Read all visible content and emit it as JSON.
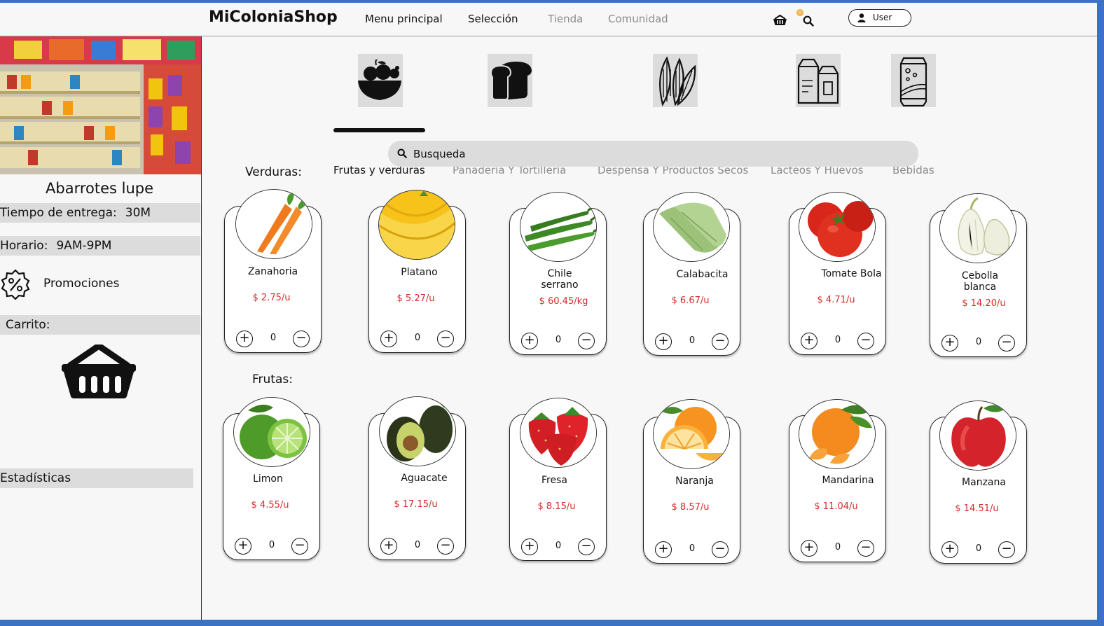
{
  "header": {
    "brand": "MiColoniaShop",
    "nav": [
      "Menu principal",
      "Selección",
      "Tienda",
      "Comunidad"
    ],
    "cart_count": "0",
    "user_label": "User"
  },
  "sidebar": {
    "store_name": "Abarrotes lupe",
    "delivery_label": "Tiempo de entrega:",
    "delivery_value": "30M",
    "hours_label": "Horario:",
    "hours_value": "9AM-9PM",
    "promotions": "Promociones",
    "cart": "Carrito:",
    "stats": "Estadísticas"
  },
  "categories": [
    {
      "label": "Frutas y verduras",
      "icon": "fruit-bowl-icon",
      "active": true
    },
    {
      "label": "Panadería Y Tortillería",
      "icon": "bread-icon",
      "active": false
    },
    {
      "label": "Despensa Y Productos Secos",
      "icon": "seeds-icon",
      "active": false
    },
    {
      "label": "Lácteos Y Huevos",
      "icon": "milk-cartons-icon",
      "active": false
    },
    {
      "label": "Bebidas",
      "icon": "soda-can-icon",
      "active": false
    }
  ],
  "search": {
    "placeholder": "Busqueda"
  },
  "sections": {
    "vegetables": "Verduras:",
    "fruits": "Frutas:"
  },
  "vegetables": [
    {
      "name": "Zanahoria",
      "price": "$ 2.75/u",
      "qty": "0",
      "kind": "carrot"
    },
    {
      "name": "Platano",
      "price": "$ 5.27/u",
      "qty": "0",
      "kind": "banana"
    },
    {
      "name": "Chile serrano",
      "price": "$ 60.45/kg",
      "qty": "0",
      "kind": "chile"
    },
    {
      "name": "Calabacita",
      "price": "$ 6.67/u",
      "qty": "0",
      "kind": "zucchini"
    },
    {
      "name": "Tomate Bola",
      "price": "$ 4.71/u",
      "qty": "0",
      "kind": "tomato"
    },
    {
      "name": "Cebolla blanca",
      "price": "$ 14.20/u",
      "qty": "0",
      "kind": "onion"
    }
  ],
  "fruits": [
    {
      "name": "Limon",
      "price": "$ 4.55/u",
      "qty": "0",
      "kind": "lime"
    },
    {
      "name": "Aguacate",
      "price": "$ 17.15/u",
      "qty": "0",
      "kind": "avocado"
    },
    {
      "name": "Fresa",
      "price": "$ 8.15/u",
      "qty": "0",
      "kind": "strawberry"
    },
    {
      "name": "Naranja",
      "price": "$ 8.57/u",
      "qty": "0",
      "kind": "orange"
    },
    {
      "name": "Mandarina",
      "price": "$ 11.04/u",
      "qty": "0",
      "kind": "mandarin"
    },
    {
      "name": "Manzana",
      "price": "$ 14.51/u",
      "qty": "0",
      "kind": "apple"
    }
  ],
  "colors": {
    "price": "#d62b2b",
    "frame": "#3b72c6",
    "panel": "#dcdcdc"
  }
}
